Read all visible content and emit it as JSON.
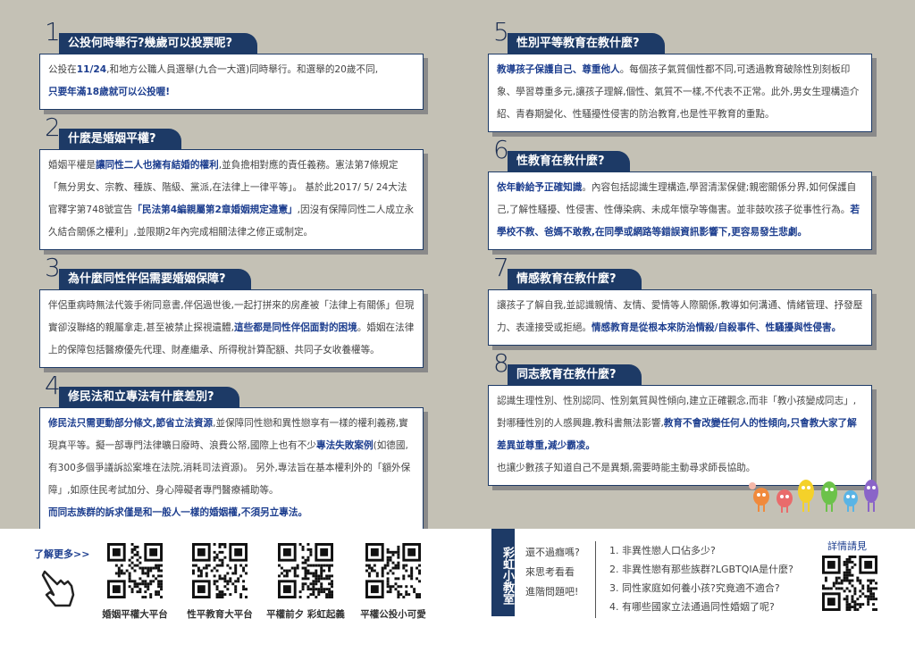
{
  "sections": {
    "s1": {
      "num": "1",
      "title": "公投何時舉行?幾歲可以投票呢?",
      "t1": "公投在",
      "t2": "11/24",
      "t3": ",和地方公職人員選舉(九合一大選)同時舉行。和選舉的20歲不同,",
      "t4": "只要年滿18歲就可以公投喔!"
    },
    "s2": {
      "num": "2",
      "title": "什麼是婚姻平權?",
      "t1": "婚姻平權是",
      "t2": "讓同性二人也擁有結婚的權利",
      "t3": ",並負擔相對應的責任義務。憲法第7條規定「無分男女、宗教、種族、階級、黨派,在法律上一律平等」。 基於此2017/ 5/ 24大法官釋字第748號宣告",
      "t4": "「民法第4編親屬第2章婚姻規定違憲」",
      "t5": ",因沒有保障同性二人成立永久結合關係之權利」,並限期2年內完成相關法律之修正或制定。"
    },
    "s3": {
      "num": "3",
      "title": "為什麼同性伴侶需要婚姻保障?",
      "t1": "伴侶重病時無法代簽手術同意書,伴侶過世後,一起打拼來的房產被「法律上有關係」但現實卻沒聯絡的親屬拿走,甚至被禁止探視遺體,",
      "t2": "這些都是同性伴侶面對的困境",
      "t3": "。婚姻在法律上的保障包括醫療優先代理、財產繼承、所得稅計算配額、共同子女收養權等。"
    },
    "s4": {
      "num": "4",
      "title": "修民法和立專法有什麼差別?",
      "t1": "修民法只需更動部分條文,節省立法資源",
      "t2": ",並保障同性戀和異性戀享有一樣的權利義務,實現真平等。擬一部專門法律曠日廢時、浪費公帑,國際上也有不少",
      "t3": "專法失敗案例",
      "t4": "(如德國,有300多個爭議訴訟案堆在法院,消耗司法資源)。 另外,專法旨在基本權利外的「額外保障」,如原住民考試加分、身心障礙者專門醫療補助等。",
      "t5": "而同志族群的訴求僅是和一般人一樣的婚姻權,不須另立專法。"
    },
    "s5": {
      "num": "5",
      "title": "性別平等教育在教什麼?",
      "t1": "教導孩子保護自己、尊重他人",
      "t2": "。每個孩子氣質個性都不同,可透過教育破除性別刻板印象、學習尊重多元,讓孩子理解,個性、氣質不一樣,不代表不正常。此外,男女生理構造介紹、青春期變化、性騷擾性侵害的防治教育,也是性平教育的重點。"
    },
    "s6": {
      "num": "6",
      "title": "性教育在教什麼?",
      "t1": "依年齡給予正確知識",
      "t2": "。內容包括認識生理構造,學習清潔保健;親密關係分界,如何保護自己,了解性騷擾、性侵害、性傳染病、未成年懷孕等傷害。並非鼓吹孩子從事性行為。",
      "t3": "若學校不教、爸媽不敢教,在同學或網路等錯誤資訊影響下,更容易發生悲劇。"
    },
    "s7": {
      "num": "7",
      "title": "情感教育在教什麼?",
      "t1": "讓孩子了解自我,並認識親情、友情、愛情等人際關係,教導如何溝通、情緒管理、抒發壓力、表達接受或拒絕。",
      "t2": "情感教育是從根本來防治情殺/自殺事件、性騷擾與性侵害。"
    },
    "s8": {
      "num": "8",
      "title": "同志教育在教什麼?",
      "t1": "認識生理性別、性別認同、性別氣質與性傾向,建立正確觀念,而非「教小孩變成同志」,對哪種性別的人感興趣,教科書無法影響,",
      "t2": "教育不會改變任何人的性傾向,只會教大家了解差異並尊重,減少霸凌。",
      "t3": "也讓少數孩子知道自己不是異類,需要時能主動尋求師長協助。"
    }
  },
  "footer": {
    "learn_more": "了解更多>>",
    "qr_labels": [
      "婚姻平權大平台",
      "性平教育大平台",
      "平權前夕 彩虹起義",
      "平權公投小可愛"
    ],
    "badge": "彩虹小教室",
    "prompt": [
      "還不過癮嗎?",
      "來思考看看",
      "進階問題吧!"
    ],
    "questions": [
      "1. 非異性戀人口佔多少?",
      "2. 非異性戀有那些族群?LGBTQIA是什麼?",
      "3. 同性家庭如何養小孩?究竟適不適合?",
      "4. 有哪些國家立法通過同性婚姻了呢?"
    ],
    "detail_label": "詳情請見"
  },
  "colors": {
    "navy": "#1d3a66",
    "highlight": "#1d3e8f",
    "background": "#c4c1b5"
  },
  "icons": [
    "pointing-hand-icon",
    "qr-code-icon",
    "mascot-group-icon"
  ]
}
